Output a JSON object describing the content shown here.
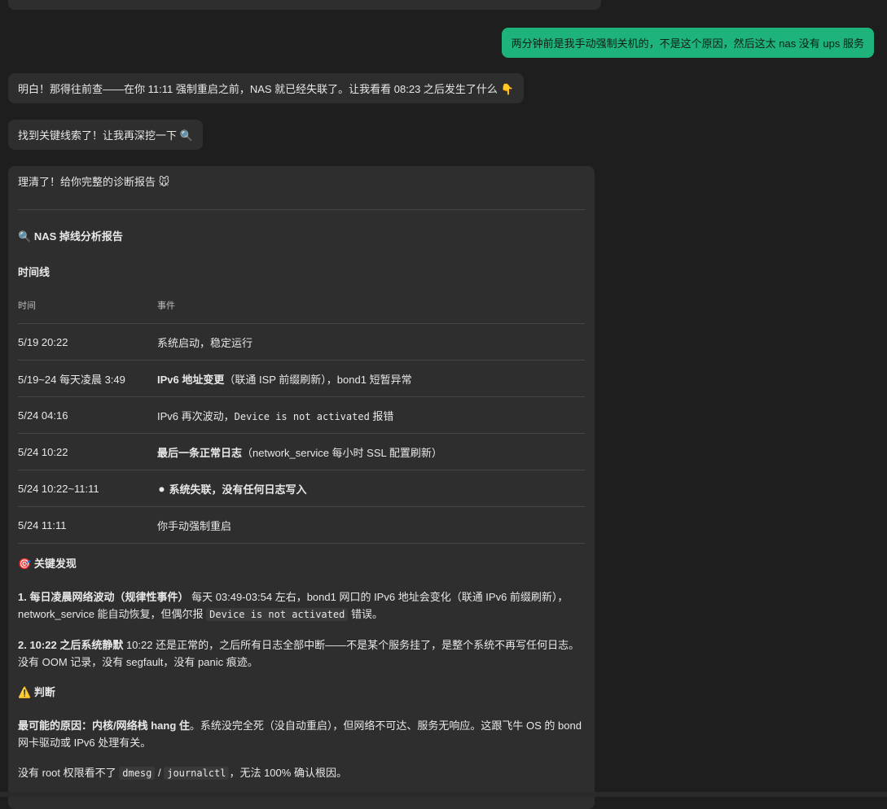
{
  "messages": {
    "user_1": "两分钟前是我手动强制关机的，不是这个原因，然后这太 nas 没有 ups 服务",
    "bot_1": "明白！那得往前查——在你 11:11 强制重启之前，NAS 就已经失联了。让我看看 08:23 之后发生了什么",
    "bot_1_emoji": "👇",
    "bot_2": "找到关键线索了！让我再深挖一下",
    "bot_2_emoji": "🔍"
  },
  "report": {
    "intro": "理清了！给你完整的诊断报告",
    "intro_emoji": "🐭",
    "title_emoji": "🔍",
    "title": "NAS 掉线分析报告",
    "timeline_heading": "时间线",
    "table": {
      "headers": [
        "时间",
        "事件"
      ],
      "rows": [
        {
          "time": "5/19 20:22",
          "event_plain": "系统启动，稳定运行"
        },
        {
          "time": "5/19~24 每天凌晨 3:49",
          "event_bold": "IPv6 地址变更",
          "event_rest": "（联通 ISP 前缀刷新），bond1 短暂异常"
        },
        {
          "time": "5/24 04:16",
          "event_pre": "IPv6 再次波动，",
          "event_code": "Device is not activated",
          "event_post": " 报错"
        },
        {
          "time": "5/24 10:22",
          "event_bold": "最后一条正常日志",
          "event_rest": "（network_service 每小时 SSL 配置刷新）"
        },
        {
          "time": "5/24 10:22~11:11",
          "event_emoji": "⚫",
          "event_bold": "系统失联，没有任何日志写入"
        },
        {
          "time": "5/24 11:11",
          "event_plain": "你手动强制重启"
        }
      ]
    },
    "findings_emoji": "🎯",
    "findings_heading": "关键发现",
    "finding_1_bold": "1. 每日凌晨网络波动（规律性事件）",
    "finding_1_text": " 每天 03:49-03:54 左右，bond1 网口的 IPv6 地址会变化（联通 IPv6 前缀刷新），network_service 能自动恢复，但偶尔报 ",
    "finding_1_code": "Device is not activated",
    "finding_1_tail": " 错误。",
    "finding_2_bold": "2. 10:22 之后系统静默",
    "finding_2_text": " 10:22 还是正常的，之后所有日志全部中断——不是某个服务挂了，是整个系统不再写任何日志。没有 OOM 记录，没有 segfault，没有 panic 痕迹。",
    "judgement_emoji": "⚠️",
    "judgement_heading": "判断",
    "judgement_bold": "最可能的原因：内核/网络栈 hang 住",
    "judgement_text": "。系统没完全死（没自动重启），但网络不可达、服务无响应。这跟飞牛 OS 的 bond 网卡驱动或 IPv6 处理有关。",
    "note_pre": "没有 root 权限看不了 ",
    "note_code_1": "dmesg",
    "note_sep": " / ",
    "note_code_2": "journalctl",
    "note_post": "，无法 100% 确认根因。"
  },
  "colors": {
    "background": "#1e1e1e",
    "bot_bubble": "#2e2e2e",
    "user_bubble": "#1fb37c"
  }
}
